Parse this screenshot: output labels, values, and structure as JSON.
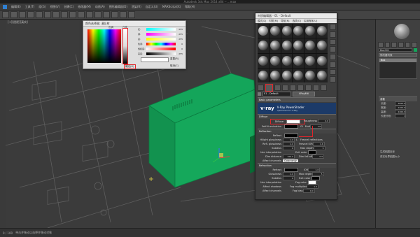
{
  "window_title": "Autodesk 3ds Max 2014 x64   -- ...max",
  "menu": [
    "编辑(E)",
    "工具(T)",
    "组(G)",
    "视图(V)",
    "创建(C)",
    "修改器(M)",
    "动画(A)",
    "图形编辑器(D)",
    "渲染(R)",
    "自定义(U)",
    "MAXScript(X)",
    "帮助(H)"
  ],
  "viewport": {
    "label": "[+][透视][真实]"
  },
  "color_picker": {
    "title": "颜色选择器: 漫反射",
    "sections": {
      "hue": "色调",
      "whiteness": "白度"
    },
    "labels": [
      "红:",
      "绿:",
      "蓝:",
      "色调:",
      "饱和度:",
      "亮度:"
    ],
    "values": [
      "255",
      "255",
      "255",
      "0",
      "0",
      "255"
    ],
    "buttons": [
      "重置(R)",
      "确定(O)",
      "取消(C)"
    ]
  },
  "material_editor": {
    "title": "材质编辑器 - 01 - Default",
    "menu": [
      "模式(D)",
      "材质(M)",
      "导航(N)",
      "选项(O)",
      "实用程序(U)"
    ],
    "name_field": "01 - Default",
    "type_button": "VRayMtl",
    "rollout": "Basic parameters",
    "vray_logo": "v·ray",
    "banner_title": "V-Ray PowerShader",
    "banner_sub": "optimized for V-Ray",
    "diffuse_section": "Diffuse",
    "reflection_section": "Reflection",
    "refraction_section": "Refraction",
    "params": {
      "diffuse": "Diffuse",
      "roughness": "Roughness",
      "roughness_val": "0.0",
      "self_illum": "Self-illumination",
      "gi": "GI",
      "mult": "Mult",
      "mult_val": "1.0",
      "reflect": "Reflect",
      "hilight_gloss": "Hilight glossiness",
      "hilight_val": "1.0",
      "l_btn": "L",
      "fresnel": "Fresnel reflections",
      "refl_gloss": "Refl. glossiness",
      "refl_gloss_val": "1.0",
      "fresnel_ior": "Fresnel IOR",
      "fresnel_ior_val": "1.6",
      "subdivs": "Subdivs",
      "subdivs_val": "8",
      "max_depth": "Max depth",
      "max_depth_val": "5",
      "use_interp": "Use interpolation",
      "exit_color": "Exit color",
      "dim_distance": "Dim distance",
      "dim_val": "100.0",
      "dim_falloff": "Dim fall off",
      "dim_falloff_val": "0.0",
      "affect_channels": "Affect channels",
      "color_only": "Color only",
      "refract": "Refract",
      "ior": "IOR",
      "ior_val": "1.6",
      "glossiness": "Glossiness",
      "gloss_val": "1.0",
      "r_max_depth": "Max depth",
      "r_max_depth_val": "5",
      "r_subdivs": "Subdivs",
      "r_subdivs_val": "8",
      "r_exit": "Exit color",
      "r_interp": "Use interpolation",
      "fog_color": "Fog color",
      "affect_shadows": "Affect shadows",
      "fog_mult": "Fog multiplier",
      "fog_mult_val": "1.0",
      "r_affect": "Affect channels",
      "fog_bias": "Fog bias",
      "fog_bias_val": "0.0"
    }
  },
  "command_panel": {
    "object_name": "Box001",
    "mod_list": "修改器列表",
    "stack_item": "Box",
    "params_title": "参数",
    "length_lbl": "长度:",
    "length_val": "3000.0",
    "width_lbl": "宽度:",
    "width_val": "2200.0",
    "height_lbl": "高度:",
    "height_val": "2400.0",
    "seg_lbl": "长度分段:",
    "seg_val": "1",
    "gen_map": "生成贴图坐标",
    "real_world": "真实世界贴图大小"
  },
  "status": {
    "frames": "0 / 100",
    "hint": "单击并拖动以选择并移动对象"
  },
  "colors": {
    "box_green": "#14a55a",
    "highlight_red": "#e0262b",
    "diffuse_swatch": "#ffffff"
  }
}
